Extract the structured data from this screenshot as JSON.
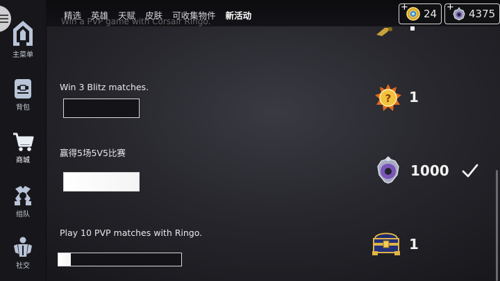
{
  "sidebar": {
    "items": [
      {
        "label": "主菜单",
        "icon": "home-icon"
      },
      {
        "label": "背包",
        "icon": "backpack-icon"
      },
      {
        "label": "商城",
        "icon": "cart-icon"
      },
      {
        "label": "组队",
        "icon": "team-icon"
      },
      {
        "label": "社交",
        "icon": "social-icon"
      }
    ]
  },
  "tabs": [
    {
      "label": "精选"
    },
    {
      "label": "英雄"
    },
    {
      "label": "天赋"
    },
    {
      "label": "皮肤"
    },
    {
      "label": "可收集物件"
    },
    {
      "label": "新活动",
      "active": true
    }
  ],
  "currency": {
    "gold": {
      "value": "24",
      "icon": "gold-coin-icon"
    },
    "silver": {
      "value": "4375",
      "icon": "silver-token-icon"
    }
  },
  "missions": {
    "faded_top": "Win a PVP game with Corsair Ringo.",
    "items": [
      {
        "title": "Win 3 Blitz matches.",
        "progress": 0.0,
        "reward_icon": "mystery-orb-icon",
        "reward_value": "1",
        "completed": false
      },
      {
        "title": "赢得5场5V5比赛",
        "progress": 1.0,
        "reward_icon": "silver-token-icon",
        "reward_value": "1000",
        "completed": true
      },
      {
        "title": "Play 10 PVP matches with Ringo.",
        "progress": 0.1,
        "reward_icon": "treasure-chest-icon",
        "reward_value": "1",
        "completed": false
      }
    ]
  },
  "colors": {
    "accent": "#ffffff",
    "background": "#26262c",
    "sidebar": "#17171b"
  }
}
